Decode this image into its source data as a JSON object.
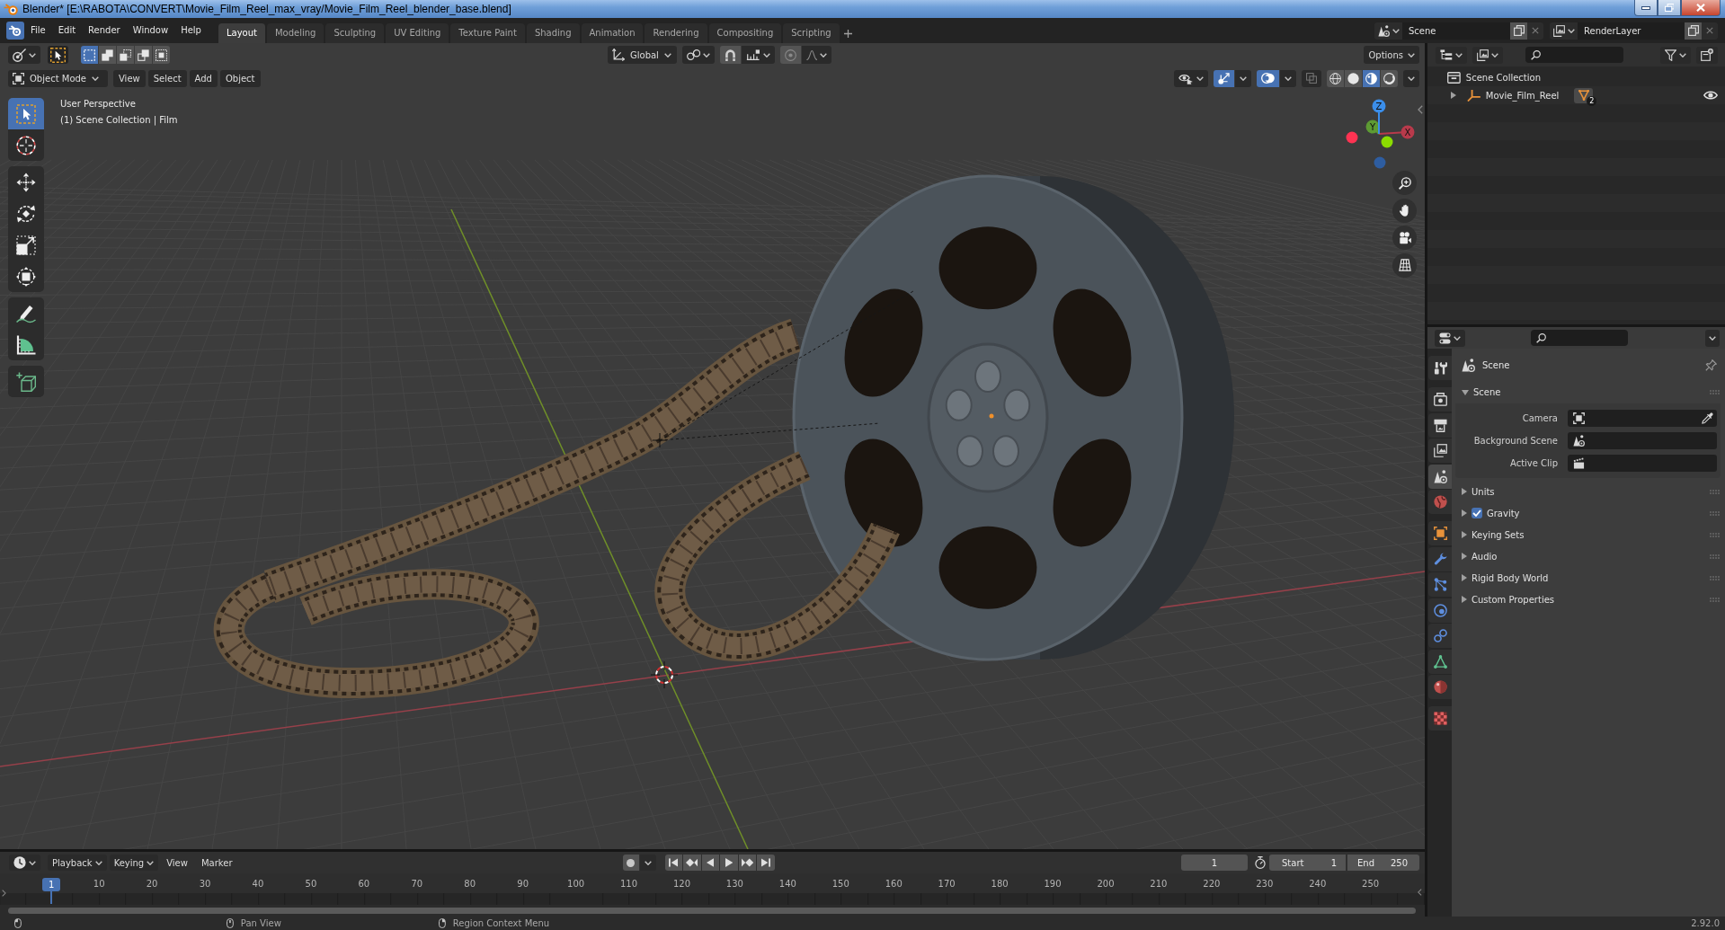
{
  "window": {
    "title": "Blender* [E:\\RABOTA\\CONVERT\\Movie_Film_Reel_max_vray/Movie_Film_Reel_blender_base.blend]"
  },
  "menu_bar": {
    "items": [
      "File",
      "Edit",
      "Render",
      "Window",
      "Help"
    ]
  },
  "workspace_tabs": [
    {
      "label": "Layout",
      "selected": true
    },
    {
      "label": "Modeling",
      "selected": false
    },
    {
      "label": "Sculpting",
      "selected": false
    },
    {
      "label": "UV Editing",
      "selected": false
    },
    {
      "label": "Texture Paint",
      "selected": false
    },
    {
      "label": "Shading",
      "selected": false
    },
    {
      "label": "Animation",
      "selected": false
    },
    {
      "label": "Rendering",
      "selected": false
    },
    {
      "label": "Compositing",
      "selected": false
    },
    {
      "label": "Scripting",
      "selected": false
    }
  ],
  "scene_selector": {
    "value": "Scene"
  },
  "view_layer_selector": {
    "value": "RenderLayer"
  },
  "tool_settings": {
    "select_modes": [
      {
        "kind": "set",
        "selected": true
      },
      {
        "kind": "extend",
        "selected": false
      },
      {
        "kind": "subtract",
        "selected": false
      },
      {
        "kind": "invert",
        "selected": false
      },
      {
        "kind": "intersect",
        "selected": false
      }
    ],
    "transform_orientation": "Global",
    "snapping": {
      "on": false
    },
    "proportional_editing": {
      "on": false
    },
    "options": "Options"
  },
  "viewport_header": {
    "mode": "Object Mode",
    "menus": [
      "View",
      "Select",
      "Add",
      "Object"
    ],
    "gizmos": {
      "on": true
    },
    "overlays": {
      "on": true
    },
    "xray": {
      "on": false
    },
    "shading_modes": [
      {
        "kind": "wireframe",
        "selected": false
      },
      {
        "kind": "solid",
        "selected": false
      },
      {
        "kind": "material",
        "selected": true
      },
      {
        "kind": "rendered",
        "selected": false
      }
    ]
  },
  "viewport": {
    "info": [
      "User Perspective",
      "(1) Scene Collection | Film"
    ],
    "tool_groups": [
      {
        "tools": [
          {
            "kind": "select_box",
            "selected": true
          },
          {
            "kind": "cursor",
            "selected": false
          }
        ]
      },
      {
        "tools": [
          {
            "kind": "move",
            "selected": false
          },
          {
            "kind": "rotate",
            "selected": false
          },
          {
            "kind": "scale",
            "selected": false
          },
          {
            "kind": "transform",
            "selected": false
          }
        ]
      },
      {
        "tools": [
          {
            "kind": "annotate",
            "selected": false
          },
          {
            "kind": "measure",
            "selected": false
          }
        ]
      },
      {
        "tools": [
          {
            "kind": "add_cube",
            "selected": false
          }
        ]
      }
    ],
    "gizmo": {
      "x_label": "X",
      "y_label": "Y",
      "z_label": "Z"
    }
  },
  "outliner": {
    "items": [
      {
        "label": "Scene Collection",
        "children": [
          {
            "label": "Movie_Film_Reel",
            "expanded": false,
            "data_count": "2",
            "visible": true
          }
        ]
      }
    ]
  },
  "properties": {
    "tab_groups": [
      {
        "tabs": [
          {
            "kind": "tool",
            "selected": false
          }
        ]
      },
      {
        "tabs": [
          {
            "kind": "render",
            "selected": false
          },
          {
            "kind": "output",
            "selected": false
          },
          {
            "kind": "view_layer",
            "selected": false
          },
          {
            "kind": "scene",
            "selected": true
          },
          {
            "kind": "world",
            "selected": false
          }
        ]
      },
      {
        "tabs": [
          {
            "kind": "object",
            "selected": false
          },
          {
            "kind": "modifiers",
            "selected": false
          },
          {
            "kind": "particles",
            "selected": false
          },
          {
            "kind": "physics",
            "selected": false
          },
          {
            "kind": "constraints",
            "selected": false
          },
          {
            "kind": "data",
            "selected": false
          },
          {
            "kind": "material",
            "selected": false
          }
        ]
      },
      {
        "tabs": [
          {
            "kind": "texture",
            "selected": false
          }
        ]
      }
    ],
    "context": "Scene",
    "panels": [
      {
        "title": "Scene",
        "expanded": true,
        "fields": [
          {
            "label": "Camera",
            "kind": "camera"
          },
          {
            "label": "Background Scene",
            "kind": "scene"
          },
          {
            "label": "Active Clip",
            "kind": "clip"
          }
        ]
      },
      {
        "title": "Units",
        "expanded": false
      },
      {
        "title": "Gravity",
        "expanded": false,
        "checkbox": {
          "checked": true
        }
      },
      {
        "title": "Keying Sets",
        "expanded": false
      },
      {
        "title": "Audio",
        "expanded": false
      },
      {
        "title": "Rigid Body World",
        "expanded": false
      },
      {
        "title": "Custom Properties",
        "expanded": false
      }
    ]
  },
  "timeline": {
    "menus": [
      {
        "label": "Playback",
        "kind": "dropdown"
      },
      {
        "label": "Keying",
        "kind": "dropdown"
      },
      {
        "label": "View",
        "kind": "menu"
      },
      {
        "label": "Marker",
        "kind": "menu"
      }
    ],
    "auto_keying": {
      "on": false
    },
    "current_frame": "1",
    "start": {
      "label": "Start",
      "value": "1"
    },
    "end": {
      "label": "End",
      "value": "250"
    },
    "playhead": "1",
    "ruler": [
      "10",
      "20",
      "30",
      "40",
      "50",
      "60",
      "70",
      "80",
      "90",
      "100",
      "110",
      "120",
      "130",
      "140",
      "150",
      "160",
      "170",
      "180",
      "190",
      "200",
      "210",
      "220",
      "230",
      "240",
      "250"
    ]
  },
  "status_bar": {
    "hints": [
      {
        "kind": "mouse_left"
      },
      {
        "kind": "mouse_middle",
        "label": "Pan View"
      },
      {
        "kind": "mouse_right",
        "label": "Region Context Menu"
      }
    ],
    "version": "2.92.0"
  }
}
